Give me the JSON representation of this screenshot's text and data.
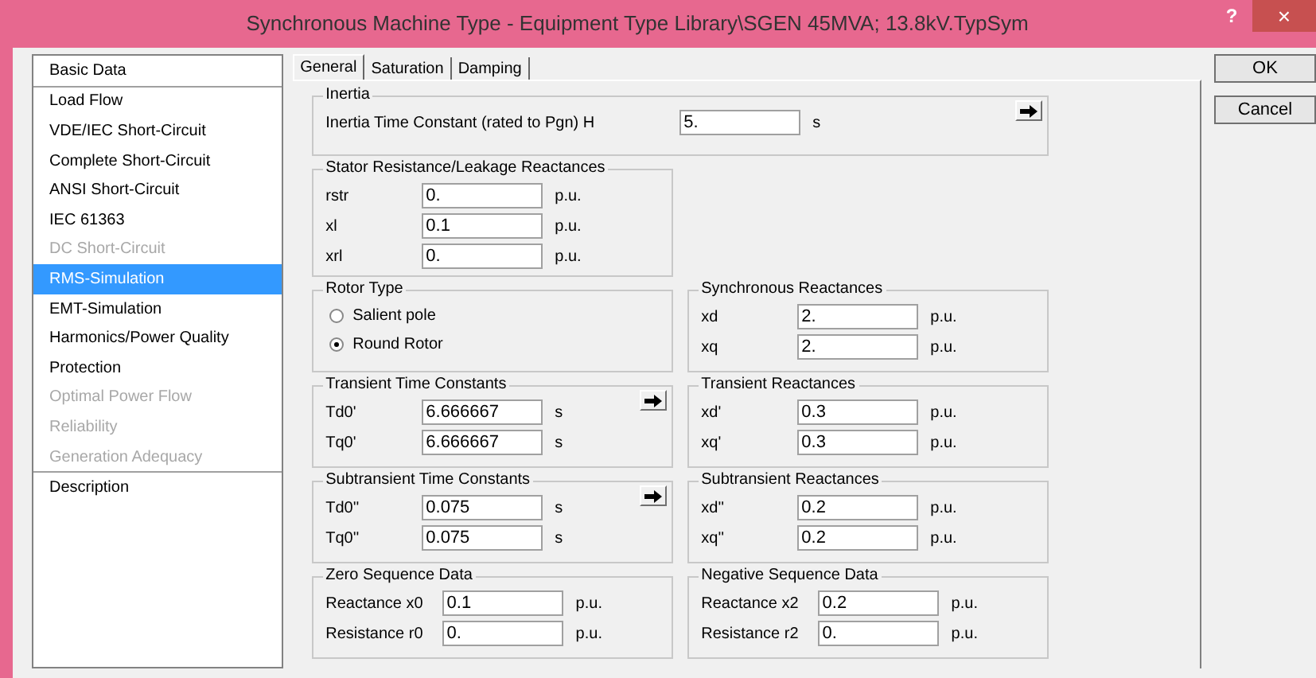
{
  "window": {
    "title": "Synchronous Machine Type - Equipment Type Library\\SGEN 45MVA; 13.8kV.TypSym",
    "help": "?",
    "close": "×"
  },
  "sidebar": {
    "sections": [
      [
        {
          "label": "Basic Data",
          "selected": false,
          "disabled": false
        }
      ],
      [
        {
          "label": "Load Flow",
          "selected": false,
          "disabled": false
        },
        {
          "label": "VDE/IEC Short-Circuit",
          "selected": false,
          "disabled": false
        },
        {
          "label": "Complete Short-Circuit",
          "selected": false,
          "disabled": false
        },
        {
          "label": "ANSI Short-Circuit",
          "selected": false,
          "disabled": false
        },
        {
          "label": "IEC 61363",
          "selected": false,
          "disabled": false
        },
        {
          "label": "DC Short-Circuit",
          "selected": false,
          "disabled": true
        },
        {
          "label": "RMS-Simulation",
          "selected": true,
          "disabled": false
        },
        {
          "label": "EMT-Simulation",
          "selected": false,
          "disabled": false
        },
        {
          "label": "Harmonics/Power Quality",
          "selected": false,
          "disabled": false
        },
        {
          "label": "Protection",
          "selected": false,
          "disabled": false
        },
        {
          "label": "Optimal Power Flow",
          "selected": false,
          "disabled": true
        },
        {
          "label": "Reliability",
          "selected": false,
          "disabled": true
        },
        {
          "label": "Generation Adequacy",
          "selected": false,
          "disabled": true
        }
      ],
      [
        {
          "label": "Description",
          "selected": false,
          "disabled": false
        }
      ]
    ]
  },
  "tabs": [
    {
      "label": "General",
      "selected": true
    },
    {
      "label": "Saturation",
      "selected": false
    },
    {
      "label": "Damping",
      "selected": false
    }
  ],
  "rows": [
    [
      {
        "title": "Inertia",
        "kind": "fields",
        "wide": true,
        "arrow": true,
        "fields": [
          {
            "label": "Inertia Time Constant (rated to Pgn) H",
            "value": "5.",
            "unit": "s"
          }
        ]
      }
    ],
    [
      {
        "title": "Stator Resistance/Leakage Reactances",
        "kind": "fields",
        "wide": false,
        "arrow": false,
        "fields": [
          {
            "label": "rstr",
            "value": "0.",
            "unit": "p.u."
          },
          {
            "label": "xl",
            "value": "0.1",
            "unit": "p.u."
          },
          {
            "label": "xrl",
            "value": "0.",
            "unit": "p.u."
          }
        ]
      }
    ],
    [
      {
        "title": "Rotor Type",
        "kind": "radio",
        "wide": false,
        "arrow": false,
        "options": [
          {
            "label": "Salient pole",
            "selected": false
          },
          {
            "label": "Round Rotor",
            "selected": true
          }
        ]
      },
      {
        "title": "Synchronous Reactances",
        "kind": "fields",
        "wide": false,
        "arrow": false,
        "fields": [
          {
            "label": "xd",
            "value": "2.",
            "unit": "p.u."
          },
          {
            "label": "xq",
            "value": "2.",
            "unit": "p.u."
          }
        ]
      }
    ],
    [
      {
        "title": "Transient Time Constants",
        "kind": "fields",
        "wide": false,
        "arrow": true,
        "fields": [
          {
            "label": "Td0'",
            "value": "6.666667",
            "unit": "s"
          },
          {
            "label": "Tq0'",
            "value": "6.666667",
            "unit": "s"
          }
        ]
      },
      {
        "title": "Transient Reactances",
        "kind": "fields",
        "wide": false,
        "arrow": false,
        "fields": [
          {
            "label": "xd'",
            "value": "0.3",
            "unit": "p.u."
          },
          {
            "label": "xq'",
            "value": "0.3",
            "unit": "p.u."
          }
        ]
      }
    ],
    [
      {
        "title": "Subtransient Time Constants",
        "kind": "fields",
        "wide": false,
        "arrow": true,
        "fields": [
          {
            "label": "Td0''",
            "value": "0.075",
            "unit": "s"
          },
          {
            "label": "Tq0''",
            "value": "0.075",
            "unit": "s"
          }
        ]
      },
      {
        "title": "Subtransient Reactances",
        "kind": "fields",
        "wide": false,
        "arrow": false,
        "fields": [
          {
            "label": "xd''",
            "value": "0.2",
            "unit": "p.u."
          },
          {
            "label": "xq''",
            "value": "0.2",
            "unit": "p.u."
          }
        ]
      }
    ],
    [
      {
        "title": "Zero Sequence Data",
        "kind": "fields",
        "wide": false,
        "arrow": false,
        "fields": [
          {
            "label": "Reactance x0",
            "value": "0.1",
            "unit": "p.u."
          },
          {
            "label": "Resistance r0",
            "value": "0.",
            "unit": "p.u."
          }
        ]
      },
      {
        "title": "Negative Sequence Data",
        "kind": "fields",
        "wide": false,
        "arrow": false,
        "fields": [
          {
            "label": "Reactance x2",
            "value": "0.2",
            "unit": "p.u."
          },
          {
            "label": "Resistance r2",
            "value": "0.",
            "unit": "p.u."
          }
        ]
      }
    ]
  ],
  "buttons": [
    "OK",
    "Cancel"
  ]
}
